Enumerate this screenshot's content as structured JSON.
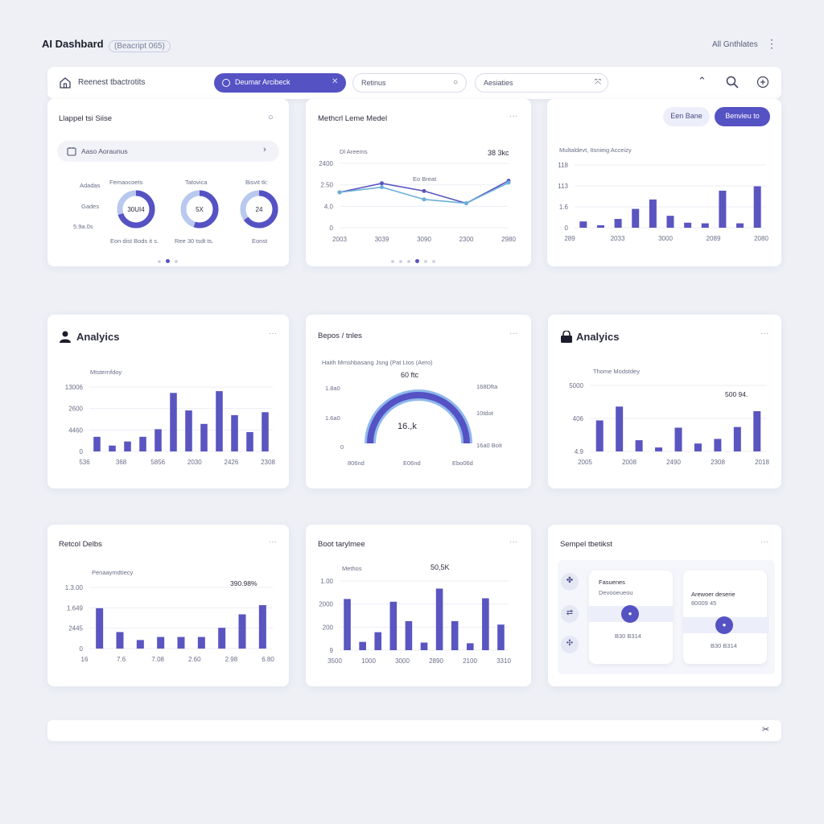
{
  "header": {
    "title": "AI Dashbard",
    "subtitle": "(Beacript 065)",
    "right_label": "All Gnthlates"
  },
  "toolbar": {
    "label": "Reenest tbactrotits",
    "primary_pill": "Deumar Arcibeck",
    "pill_2": "Retinus",
    "pill_3": "Aesiaties"
  },
  "cards": {
    "c1": {
      "title": "Llappel tsi Siise",
      "search_label": "Aaso Aoraunus",
      "left_labels": [
        "Adadas",
        "Gades",
        "5.9a.0s"
      ],
      "col_labels": [
        "Femaocoets",
        "Tatovica",
        "Bisvit tk:"
      ],
      "donut_values": [
        "30UI4",
        "5X",
        "24"
      ],
      "donut_fractions": [
        0.7,
        0.55,
        0.65
      ],
      "foot_labels": [
        "Eon dist Bods it s.",
        "Ree 30 tsdt ts.",
        "Eonst"
      ]
    },
    "c2": {
      "title": "Methcrl Leme Medel",
      "series_label": "Dl Areems",
      "annotation": "Eo Breat",
      "value_label": "38 3kc"
    },
    "c3": {
      "btn_soft": "Een Bane",
      "btn_solid": "Benvieu to",
      "chart_title": "Multaldevt, Itsnieig Acceizy"
    },
    "c4": {
      "title": "Analyics",
      "chart_title": "Mtsternfdoy"
    },
    "c5": {
      "title": "Bepos / tnles",
      "subtitle": "Haith Mmshbasang Jsng (Pat Ltos (Aero)",
      "gauge_top": "60 ftc",
      "gauge_value": "16.,k",
      "gauge_fraction": 0.8,
      "left_ticks": [
        "1.8a0",
        "1.6a0",
        "0"
      ],
      "right_ticks": [
        "168Dfta",
        "10tdot",
        "16a0 Boit"
      ],
      "bottom_ticks": [
        "806nd",
        "E06nd",
        "Ebo06d"
      ]
    },
    "c6": {
      "title": "Analyics",
      "chart_title": "Thome Modstdey",
      "value_label": "500 94."
    },
    "c7": {
      "title": "Retcol Delbs",
      "chart_title": "Penaaymdtiecy",
      "value_label": "390.98%"
    },
    "c8": {
      "title": "Boot tarylmee",
      "chart_title": "Methos",
      "value_label": "50,5K"
    },
    "c9": {
      "title": "Sempel tbetikst",
      "tile1_title": "Fasuenes",
      "tile1_sub": "Devooeueou",
      "tile1_foot": "B30 B314",
      "tile2_title": "Arewoer deserie",
      "tile2_sub": "80009 45",
      "tile2_foot": "B30 B314"
    }
  },
  "chart_data": [
    {
      "type": "line",
      "x": [
        "2003",
        "3039",
        "3090",
        "2300",
        "2980"
      ],
      "y_ticks": [
        "0",
        "4.0",
        "2.50",
        "2400"
      ],
      "series": [
        {
          "values": [
            55,
            69,
            57,
            38,
            73
          ]
        },
        {
          "values": [
            55,
            63,
            44,
            38,
            70
          ]
        }
      ]
    },
    {
      "type": "bar",
      "categories": [
        "289",
        "2033",
        "3000",
        "2089",
        "2080"
      ],
      "y_ticks": [
        "0",
        "1.6",
        "113",
        "118"
      ],
      "values": [
        10,
        4,
        14,
        30,
        45,
        19,
        8,
        7,
        59,
        7,
        66
      ]
    },
    {
      "type": "bar",
      "categories": [
        "536",
        "368",
        "5856",
        "2030",
        "2426",
        "2308"
      ],
      "y_ticks": [
        "0",
        "4460",
        "2600",
        "13006"
      ],
      "values": [
        25,
        10,
        17,
        25,
        38,
        100,
        70,
        47,
        103,
        62,
        33,
        67
      ]
    },
    {
      "type": "bar",
      "categories": [
        "2005",
        "2008",
        "2490",
        "2308",
        "2018"
      ],
      "y_ticks": [
        "4.9",
        "406",
        "5000"
      ],
      "values": [
        47,
        68,
        17,
        6,
        36,
        12,
        19,
        37,
        61
      ]
    },
    {
      "type": "bar",
      "categories": [
        "16",
        "7.6",
        "7.08",
        "2.60",
        "2.98",
        "6.80"
      ],
      "y_ticks": [
        "0",
        "2445",
        "1.649",
        "1.3.00"
      ],
      "values": [
        66,
        27,
        14,
        19,
        19,
        19,
        34,
        56,
        71
      ]
    },
    {
      "type": "bar",
      "categories": [
        "3500",
        "1000",
        "3000",
        "2890",
        "2100",
        "3310"
      ],
      "y_ticks": [
        "9",
        "200",
        "2000",
        "1.00"
      ],
      "values": [
        74,
        12,
        26,
        70,
        42,
        11,
        89,
        42,
        10,
        75,
        37
      ]
    }
  ]
}
